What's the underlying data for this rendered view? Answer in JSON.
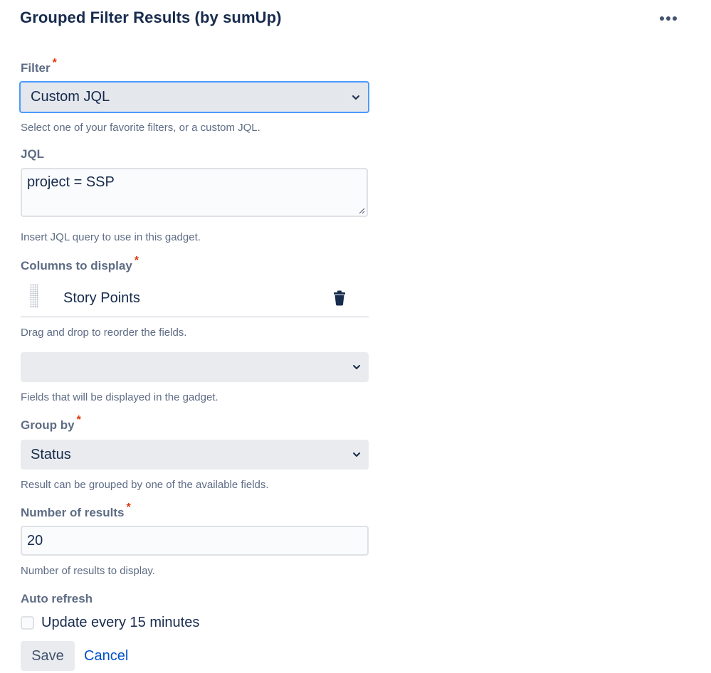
{
  "header": {
    "title": "Grouped Filter Results (by sumUp)",
    "menu_icon": "more-horizontal-icon"
  },
  "filter": {
    "label": "Filter",
    "required_marker": "*",
    "value": "Custom JQL",
    "help": "Select one of your favorite filters, or a custom JQL."
  },
  "jql": {
    "label": "JQL",
    "value": "project = SSP",
    "help": "Insert JQL query to use in this gadget."
  },
  "columns": {
    "label": "Columns to display",
    "required_marker": "*",
    "items": [
      {
        "name": "Story Points"
      }
    ],
    "reorder_help": "Drag and drop to reorder the fields.",
    "add_value": "",
    "help": "Fields that will be displayed in the gadget."
  },
  "group_by": {
    "label": "Group by",
    "required_marker": "*",
    "value": "Status",
    "help": "Result can be grouped by one of the available fields."
  },
  "num_results": {
    "label": "Number of results",
    "required_marker": "*",
    "value": "20",
    "help": "Number of results to display."
  },
  "auto_refresh": {
    "label": "Auto refresh",
    "checkbox_label": "Update every 15 minutes",
    "checked": false
  },
  "actions": {
    "save_label": "Save",
    "cancel_label": "Cancel"
  },
  "colors": {
    "text": "#172b4d",
    "label": "#5e6c84",
    "required": "#de350b",
    "link": "#0052cc",
    "focus": "#4c9aff",
    "field_bg": "#e9ebee"
  }
}
